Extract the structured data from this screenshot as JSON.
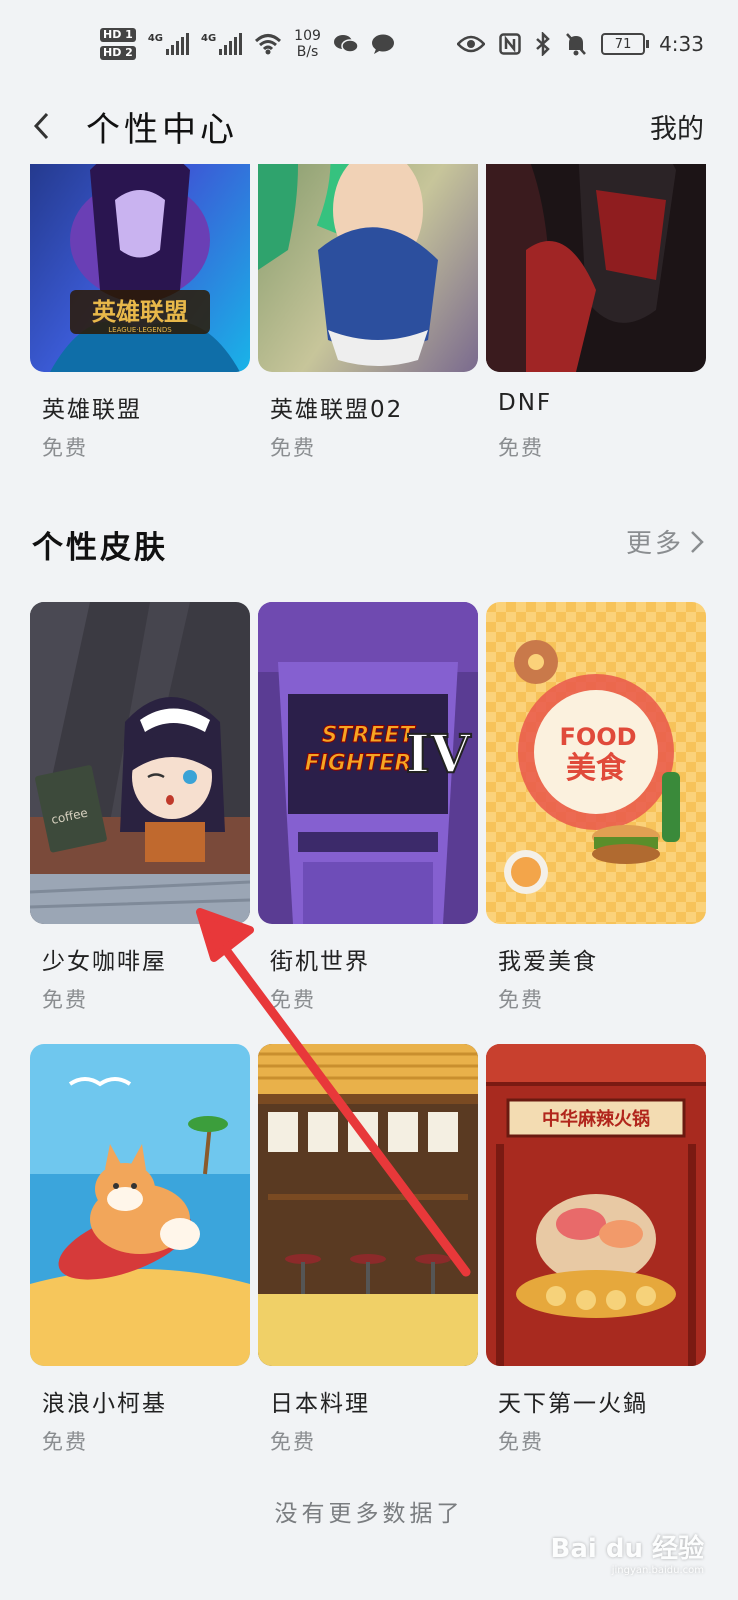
{
  "status_bar": {
    "hd1": "HD 1",
    "hd2": "HD 2",
    "net1": "4G",
    "net2": "4G",
    "speed_value": "109",
    "speed_unit": "B/s",
    "battery": "71",
    "time": "4:33"
  },
  "header": {
    "title": "个性中心",
    "right_link": "我的"
  },
  "top_row": [
    {
      "name": "英雄联盟",
      "price": "免费"
    },
    {
      "name": "英雄联盟02",
      "price": "免费"
    },
    {
      "name": "DNF",
      "price": "免费"
    }
  ],
  "section": {
    "title": "个性皮肤",
    "more": "更多"
  },
  "skins_row1": [
    {
      "name": "少女咖啡屋",
      "price": "免费"
    },
    {
      "name": "街机世界",
      "price": "免费"
    },
    {
      "name": "我爱美食",
      "price": "免费"
    }
  ],
  "skins_row2": [
    {
      "name": "浪浪小柯基",
      "price": "免费"
    },
    {
      "name": "日本料理",
      "price": "免费"
    },
    {
      "name": "天下第一火鍋",
      "price": "免费"
    }
  ],
  "art_text": {
    "lol_logo": "英雄联盟",
    "lol_sub": "LEAGUE·LEGENDS",
    "coffee": "coffee",
    "street": "STREET",
    "fighter": "FIGHTER",
    "four": "IV",
    "food": "FOOD",
    "food_cn": "美食",
    "hotpot_sign": "中华麻辣火锅"
  },
  "footer_note": "没有更多数据了",
  "watermark": {
    "brand": "Bai du 经验",
    "url": "jingyan.baidu.com"
  }
}
